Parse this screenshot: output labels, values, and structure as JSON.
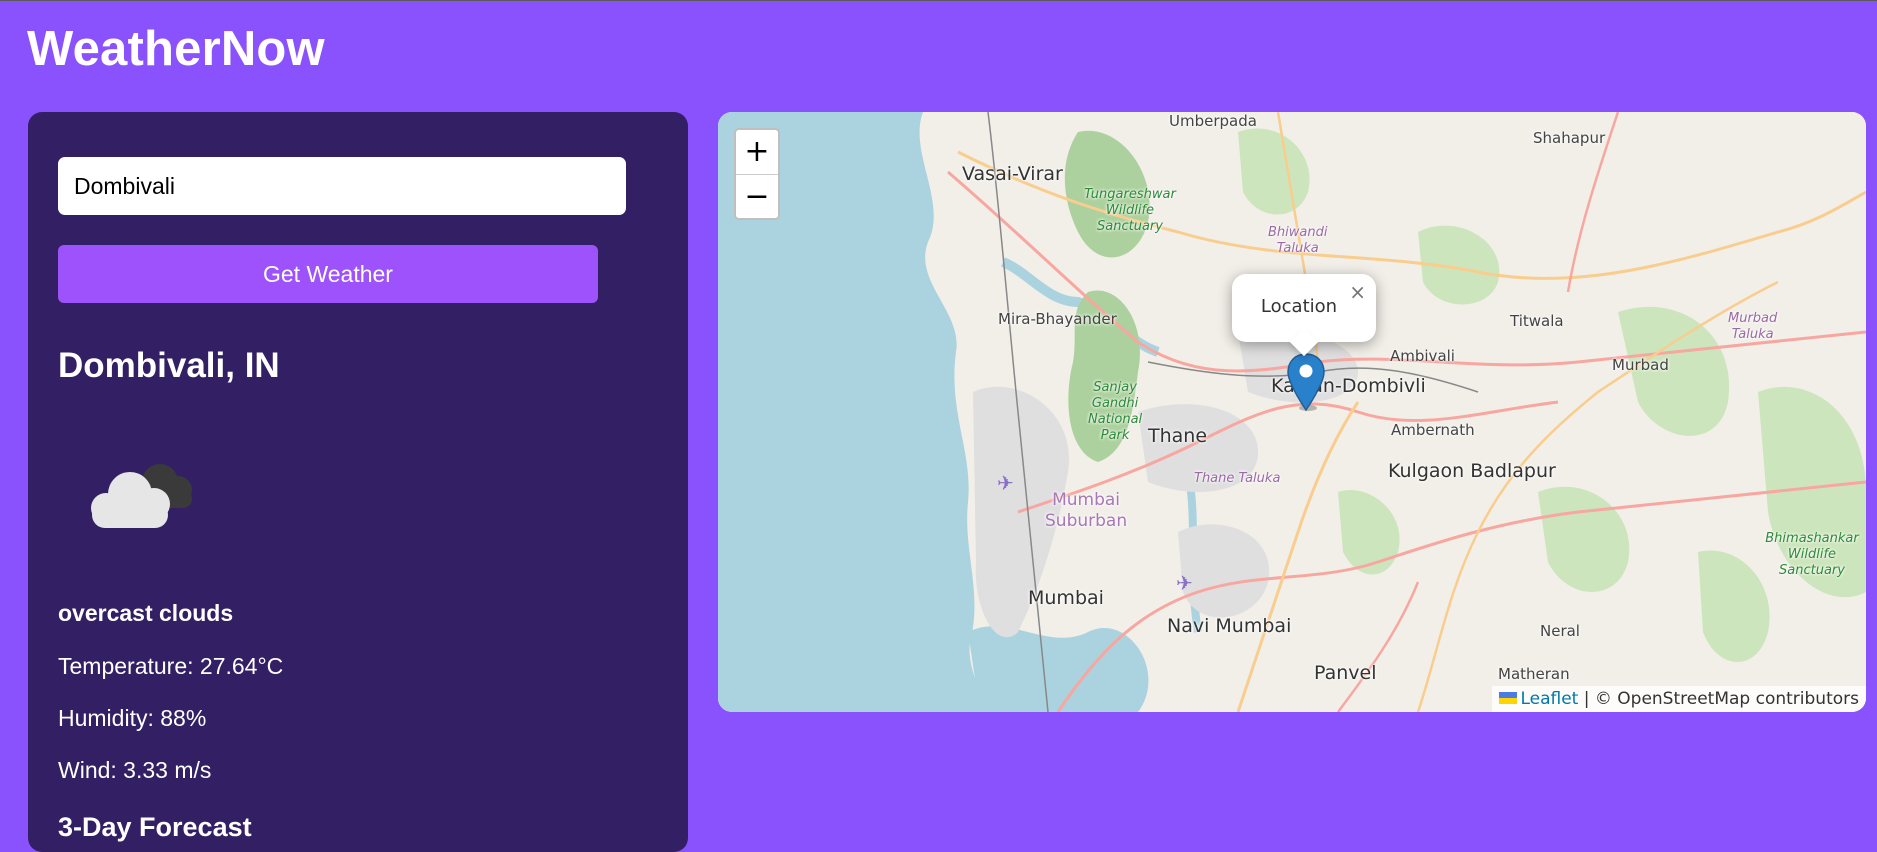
{
  "app": {
    "title": "WeatherNow"
  },
  "search": {
    "value": "Dombivali",
    "button_label": "Get Weather"
  },
  "current": {
    "city": "Dombivali, IN",
    "icon": "overcast-cloud-icon",
    "description": "overcast clouds",
    "temperature": "Temperature: 27.64°C",
    "humidity": "Humidity: 88%",
    "wind": "Wind: 3.33 m/s"
  },
  "forecast": {
    "heading": "3-Day Forecast"
  },
  "map": {
    "zoom_in": "+",
    "zoom_out": "−",
    "popup_text": "Location",
    "popup_close": "×",
    "marker_icon": "map-marker-icon",
    "attribution": {
      "leaflet": "Leaflet",
      "separator": " | ",
      "osm": "© OpenStreetMap contributors"
    },
    "place_labels": [
      "Umberpada",
      "Shahapur",
      "Vasai-Virar",
      "Tungareshwar Wildlife Sanctuary",
      "Bhiwandi Taluka",
      "Mira-Bhayander",
      "Titwala",
      "Murbad Taluka",
      "Ambivali",
      "Murbad",
      "Kalyan-Dombivli",
      "Sanjay Gandhi National Park",
      "Thane",
      "Ambernath",
      "Thane Taluka",
      "Kulgaon Badlapur",
      "Mumbai Suburban",
      "Bhimashankar Wildlife Sanctuary",
      "Mumbai",
      "Navi Mumbai",
      "Neral",
      "Matheran",
      "Panvel"
    ]
  },
  "colors": {
    "page_bg": "#8a52fd",
    "panel_bg": "#331f63",
    "button_bg": "#9d52fc",
    "water": "#aad3df",
    "marker": "#2a81cb",
    "link": "#0078a8"
  }
}
